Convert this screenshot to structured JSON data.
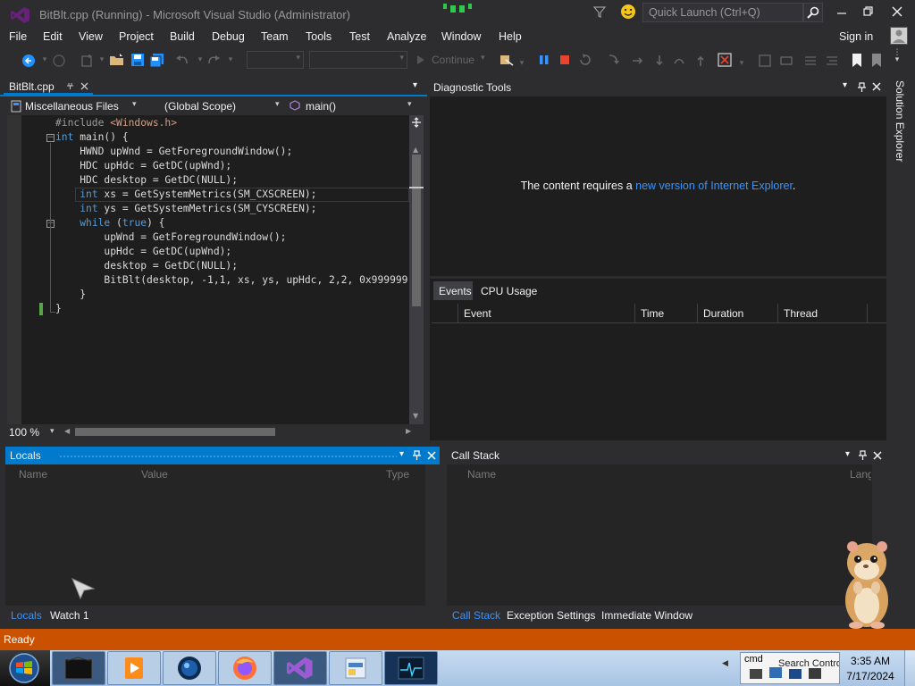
{
  "window": {
    "title": "BitBlt.cpp (Running) - Microsoft Visual Studio (Administrator)",
    "quick_launch_placeholder": "Quick Launch (Ctrl+Q)"
  },
  "menu": [
    "File",
    "Edit",
    "View",
    "Project",
    "Build",
    "Debug",
    "Team",
    "Tools",
    "Test",
    "Analyze",
    "Window",
    "Help"
  ],
  "sign_in": "Sign in",
  "toolbar": {
    "continue_label": "Continue"
  },
  "editor": {
    "tab_label": "BitBlt.cpp",
    "nav_project": "Miscellaneous Files",
    "nav_scope": "(Global Scope)",
    "nav_member": "main()",
    "zoom": "100 %"
  },
  "diagnostic": {
    "title": "Diagnostic Tools",
    "message_pre": "The content requires a ",
    "message_link": "new version of Internet Explorer",
    "message_post": ".",
    "tabs": [
      "Events",
      "CPU Usage"
    ],
    "columns": [
      "Event",
      "Time",
      "Duration",
      "Thread"
    ]
  },
  "solution_explorer": "Solution Explorer",
  "locals": {
    "title": "Locals",
    "columns": [
      "Name",
      "Value",
      "Type"
    ],
    "tabs": [
      "Locals",
      "Watch 1"
    ]
  },
  "callstack": {
    "title": "Call Stack",
    "columns": [
      "Name",
      "Lang"
    ],
    "tabs": [
      "Call Stack",
      "Exception Settings",
      "Immediate Window"
    ]
  },
  "status": {
    "text": "Ready"
  },
  "taskbar": {
    "time": "3:35 AM",
    "date": "7/17/2024",
    "tray_label_1": "cmd",
    "tray_label_2": "Search Contro"
  },
  "colors": {
    "accent": "#007acc",
    "status_bar": "#ca5100",
    "editor_bg": "#1e1e1e",
    "chrome_bg": "#2d2d30",
    "link": "#3794ff",
    "taskbar": "#a9c4e4"
  }
}
